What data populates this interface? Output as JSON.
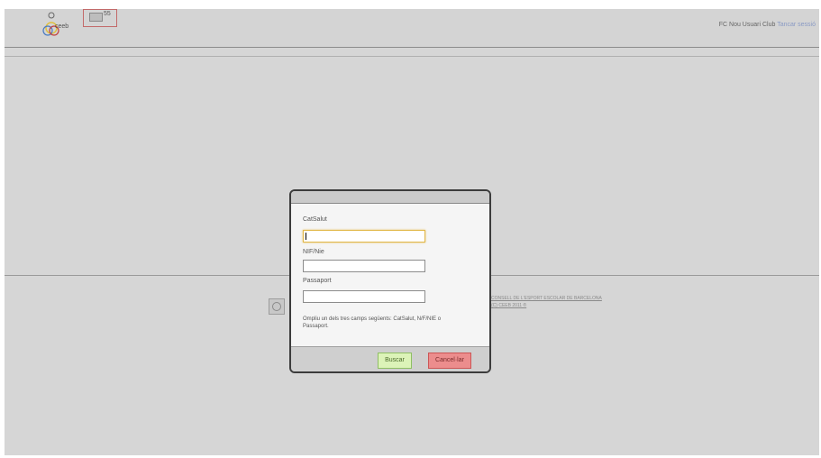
{
  "header": {
    "logo_text": "ceeb",
    "mail_count": "55",
    "user_label": "FC Nou Usuari Club",
    "logout_label": "Tancar sessió"
  },
  "footer": {
    "line1": "CONSELL DE L'ESPORT ESCOLAR DE BARCELONA",
    "line2": "(C) CEEB 2011 ®"
  },
  "modal": {
    "fields": [
      {
        "label": "CatSalut",
        "value": "",
        "placeholder": ""
      },
      {
        "label": "NIF/Nie",
        "value": "",
        "placeholder": ""
      },
      {
        "label": "Passaport",
        "value": "",
        "placeholder": ""
      }
    ],
    "hint": "Ompliu un dels tres camps següents: CatSalut, N/F/NIE o Passaport.",
    "search_label": "Buscar",
    "cancel_label": "Cancel·lar"
  },
  "colors": {
    "search_button": "#dcf3b8",
    "cancel_button": "#ec8d8d",
    "active_input_border": "#e1b84a",
    "logout_link": "#8a9ac4"
  },
  "icons": {
    "logo": "ceeb-logo-icon",
    "mail": "envelope-icon",
    "footer": "ceeb-footer-icon"
  }
}
